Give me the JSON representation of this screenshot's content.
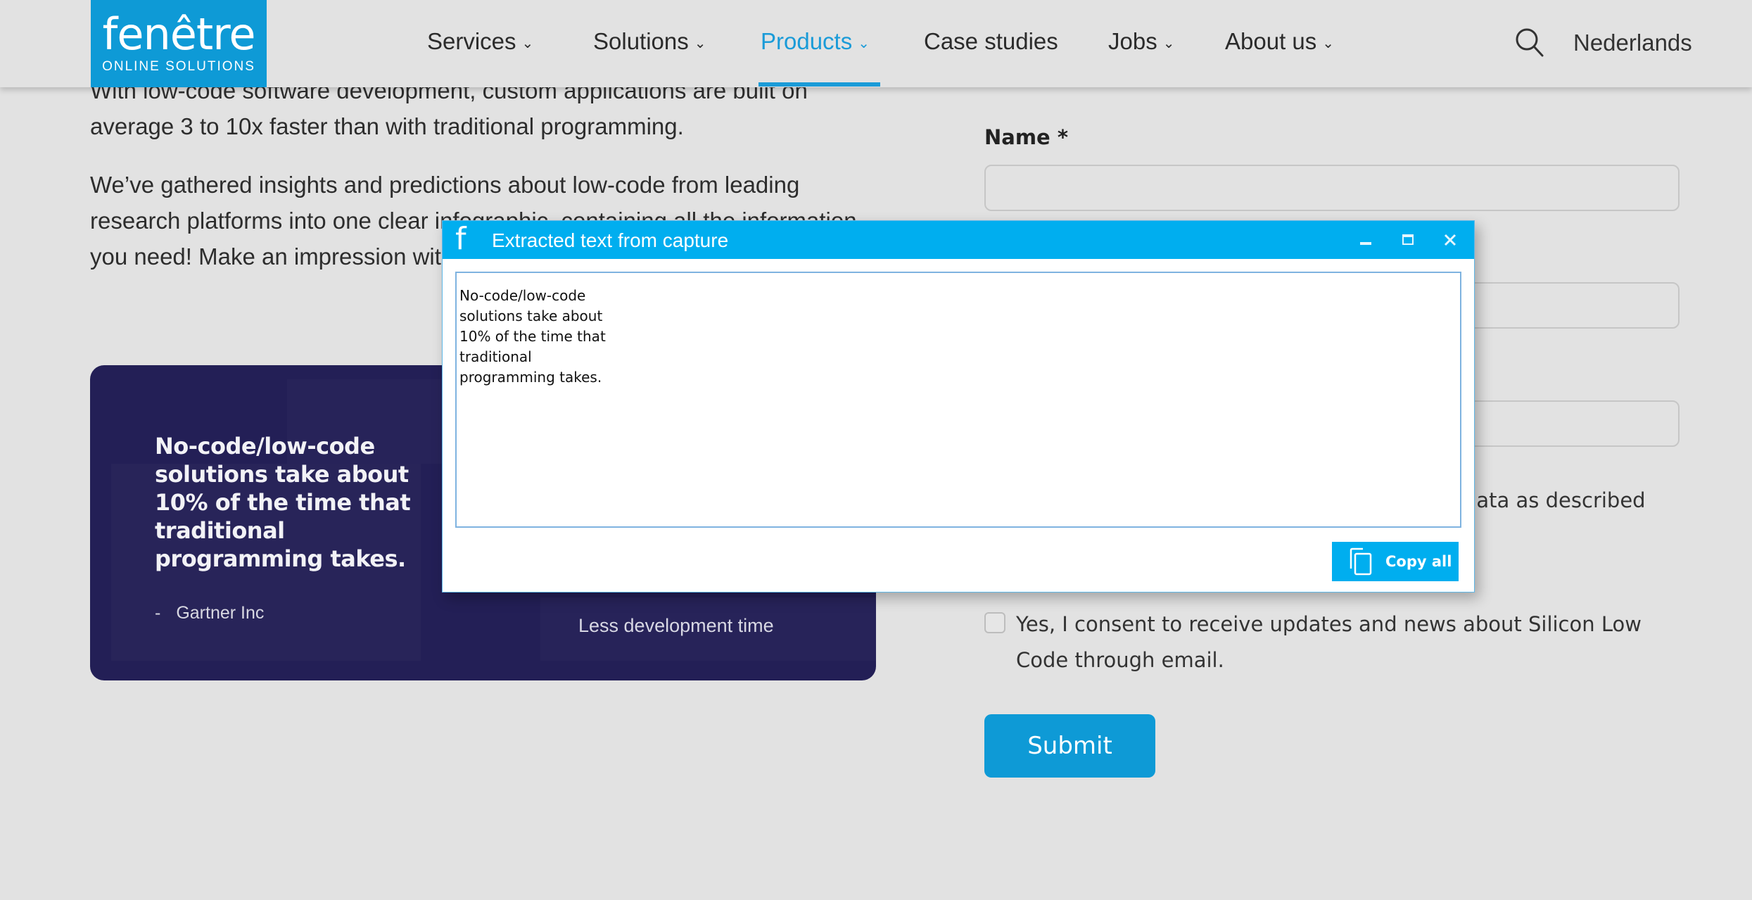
{
  "header": {
    "logo": {
      "wordmark": "fenêtre",
      "tagline": "ONLINE SOLUTIONS"
    },
    "nav": [
      {
        "label": "Services",
        "has_dropdown": true,
        "active": false
      },
      {
        "label": "Solutions",
        "has_dropdown": true,
        "active": false
      },
      {
        "label": "Products",
        "has_dropdown": true,
        "active": true
      },
      {
        "label": "Case studies",
        "has_dropdown": false,
        "active": false
      },
      {
        "label": "Jobs",
        "has_dropdown": true,
        "active": false
      },
      {
        "label": "About us",
        "has_dropdown": true,
        "active": false
      }
    ],
    "dropdown_glyph": "⌄",
    "search_icon": "search-icon",
    "language": "Nederlands"
  },
  "content": {
    "paragraph1": "With low-code software development, custom applications are built on average 3 to 10x faster than with traditional programming.",
    "paragraph2": "We’ve gathered insights and predictions about low-code from leading research platforms into one clear infographic, containing all the information you need! Make an impression with the PDF now."
  },
  "card": {
    "quote": "No-code/low-code solutions take about 10% of the time that traditional programming takes.",
    "source_dash": "-",
    "source": "Gartner Inc",
    "stat_caption": "Less development time"
  },
  "form": {
    "name_label": "Name *",
    "name_value": "",
    "field2_value": "",
    "field3_value": "",
    "privacy_partial": "data as described",
    "consent_label": "Yes, I consent to receive updates and news about Silicon Low Code through email.",
    "consent_checked": false,
    "submit_label": "Submit"
  },
  "dialog": {
    "icon": "f",
    "title": "Extracted text from capture",
    "extracted_text": "No-code/low-code\nsolutions take about\n10% of the time that\ntraditional\nprogramming takes.",
    "copy_label": "Copy all",
    "controls": [
      "minimize",
      "maximize",
      "close"
    ]
  },
  "colors": {
    "brand_blue": "#0e9ad6",
    "dialog_blue": "#00aeef",
    "card_navy": "#231f56",
    "background": "#e2e2e2"
  }
}
